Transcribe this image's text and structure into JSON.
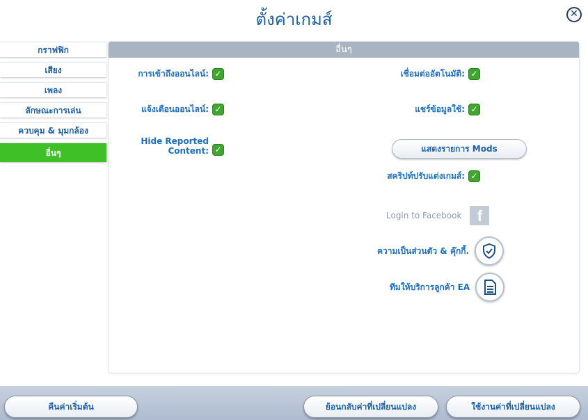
{
  "window": {
    "title": "ตั้งค่าเกมส์",
    "close_symbol": "✕"
  },
  "sidebar": {
    "items": [
      {
        "label": "กราฟฟิก",
        "active": false
      },
      {
        "label": "เสียง",
        "active": false
      },
      {
        "label": "เพลง",
        "active": false
      },
      {
        "label": "ลักษณะการเล่น",
        "active": false
      },
      {
        "label": "ควบคุม & มุมกล้อง",
        "active": false
      },
      {
        "label": "อื่นๆ",
        "active": true
      }
    ]
  },
  "panel": {
    "header": "อื่นๆ",
    "left_options": [
      {
        "label": "การเข้าถึงออนไลน์:",
        "checked": true
      },
      {
        "label": "แจ้งเตือนออนไลน์:",
        "checked": true
      },
      {
        "label_line1": "Hide Reported",
        "label_line2": "Content:",
        "checked": true
      }
    ],
    "right_options": [
      {
        "label": "เชื่อมต่ออัตโนมัติ:",
        "checked": true
      },
      {
        "label": "แชร์ข้อมูลใช้:",
        "checked": true
      },
      {
        "label": "สคริปท์ปรับแต่งเกมส์:",
        "checked": true
      }
    ],
    "mods_button": "แสดงรายการ Mods",
    "links": [
      {
        "label": "Login to Facebook",
        "icon": "facebook-icon"
      },
      {
        "label": "ความเป็นส่วนตัว & คุ๊กกี้.",
        "icon": "shield-check-icon"
      },
      {
        "label": "ทีมให้บริการลูกค้า EA",
        "icon": "document-icon"
      }
    ],
    "check_symbol": "✓",
    "fb_letter": "f"
  },
  "footer": {
    "reset_button": "คืนค่าเริ่มต้น",
    "revert_button": "ย้อนกลับค่าที่เปลี่ยนแปลง",
    "apply_button": "ใช้งานค่าที่เปลี่ยนแปลง"
  },
  "colors": {
    "accent_green": "#3fc027",
    "title_blue": "#1b5fa8",
    "header_gray": "#a9b4c2"
  }
}
